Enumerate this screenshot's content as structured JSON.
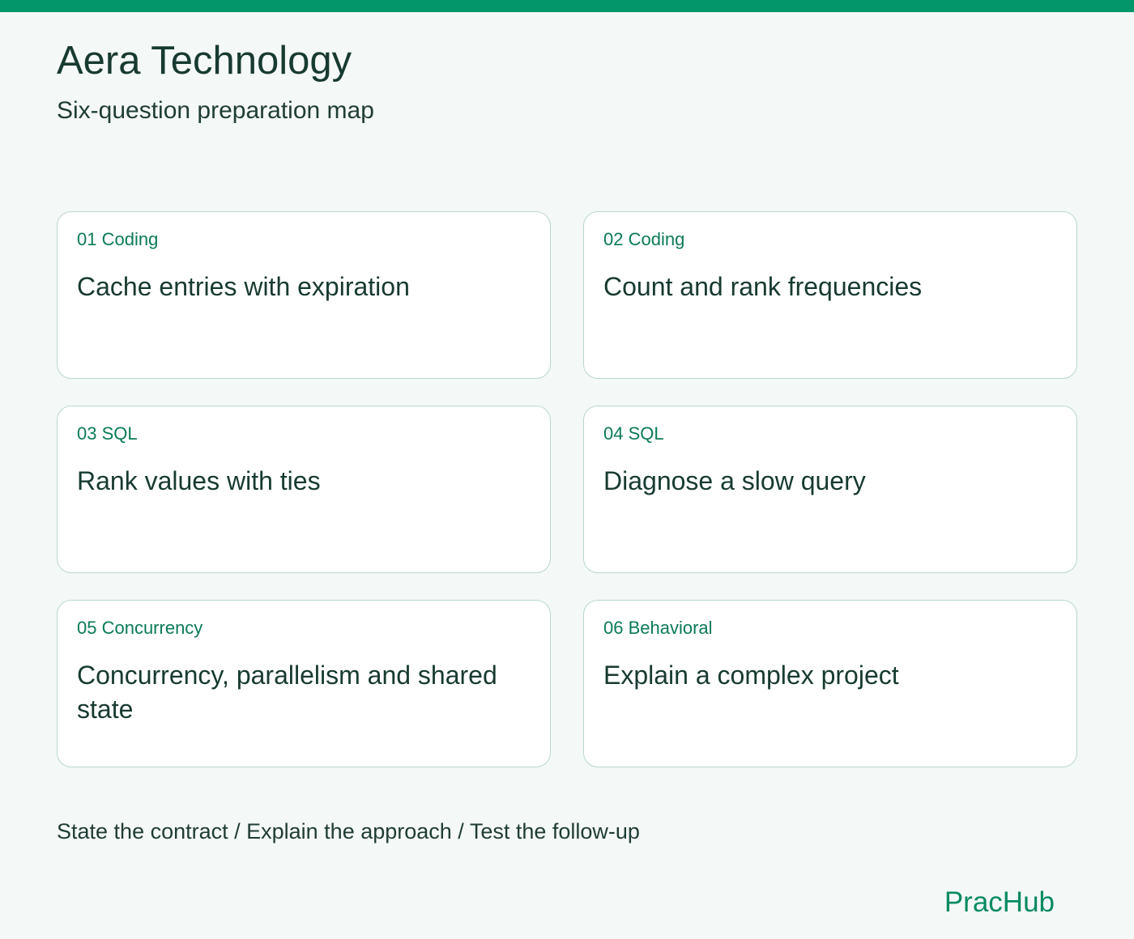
{
  "header": {
    "title": "Aera Technology",
    "subtitle": "Six-question preparation map"
  },
  "colors": {
    "accent": "#03966b",
    "tag_text": "#0b7a58",
    "background": "#f4f8f6",
    "card_border": "#b9d7cc",
    "text": "#173a31"
  },
  "cards": [
    {
      "tag": "01 Coding",
      "title": "Cache entries with expiration"
    },
    {
      "tag": "02 Coding",
      "title": "Count and rank frequencies"
    },
    {
      "tag": "03 SQL",
      "title": "Rank values with ties"
    },
    {
      "tag": "04 SQL",
      "title": "Diagnose a slow query"
    },
    {
      "tag": "05 Concurrency",
      "title": "Concurrency, parallelism and shared state"
    },
    {
      "tag": "06 Behavioral",
      "title": "Explain a complex project"
    }
  ],
  "footer": {
    "steps": "State the contract / Explain the approach / Test the follow-up",
    "brand": "PracHub"
  }
}
